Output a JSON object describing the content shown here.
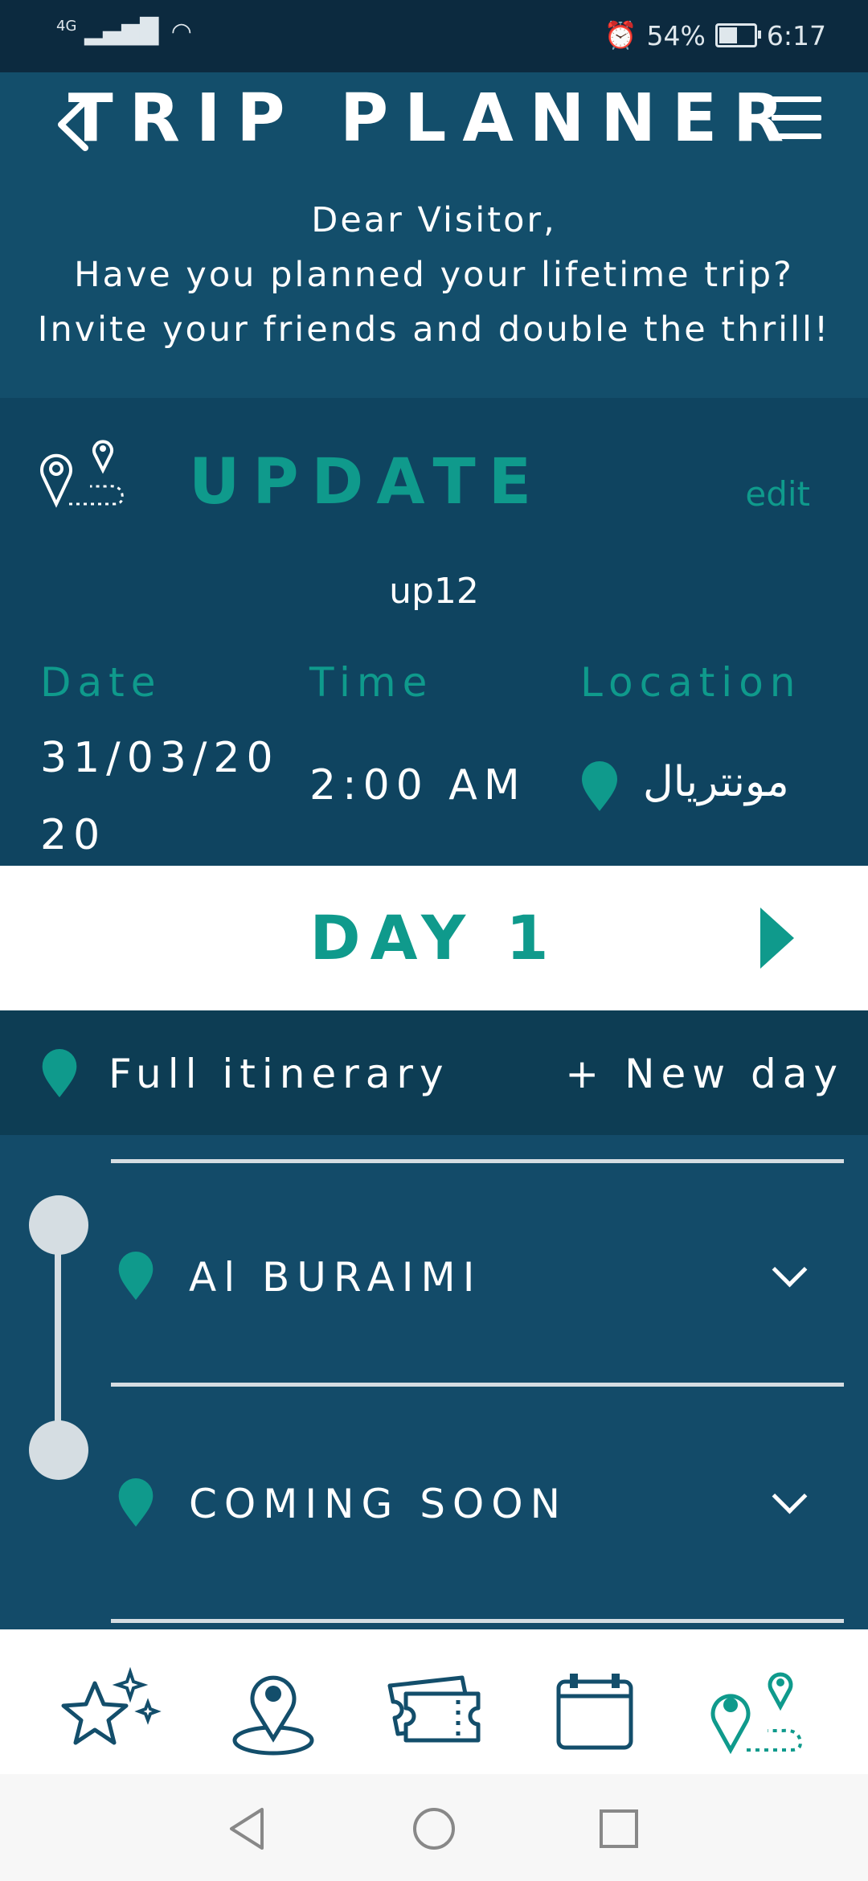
{
  "status": {
    "network": "4G",
    "alarm_icon": "alarm-icon",
    "battery": "54%",
    "battery_level": 0.54,
    "time": "6:17"
  },
  "header": {
    "title": "TRIP PLANNER",
    "greeting": [
      "Dear Visitor,",
      "Have you planned your lifetime trip?",
      "Invite your friends and double the thrill!"
    ]
  },
  "update": {
    "title": "UPDATE",
    "edit_label": "edit",
    "name": "up12",
    "date_label": "Date",
    "time_label": "Time",
    "location_label": "Location",
    "date_line1": "31/03/20",
    "date_line2": "20",
    "time_value": "2:00 AM",
    "location_value": "مونتريال"
  },
  "day": {
    "label": "DAY 1"
  },
  "itinerary": {
    "full_label": "Full itinerary",
    "new_day_label": "+ New day"
  },
  "stops": [
    {
      "name": "Al BURAIMI"
    },
    {
      "name": "COMING SOON"
    }
  ],
  "nav": [
    "star-sparkle-icon",
    "map-pin-icon",
    "ticket-icon",
    "calendar-icon",
    "route-icon"
  ],
  "colors": {
    "accent": "#0f9a8c",
    "header_bg": "#134e6b",
    "card_bg": "#0f4460",
    "nav_icon": "#134e6b"
  }
}
